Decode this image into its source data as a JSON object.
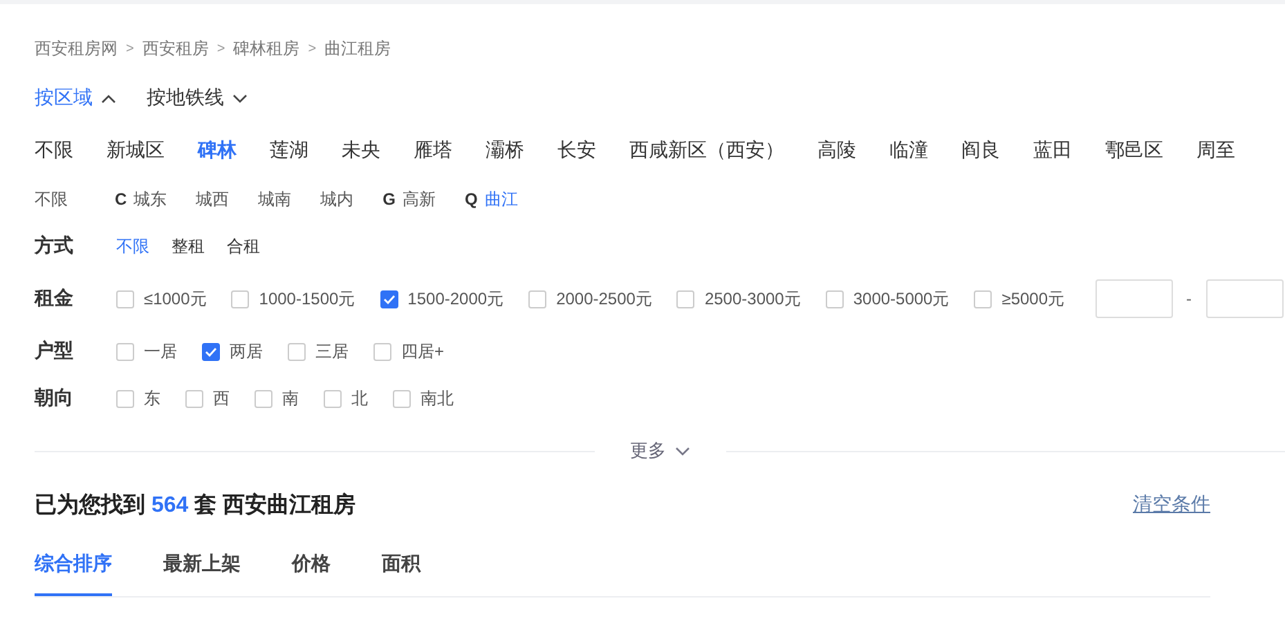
{
  "breadcrumb": [
    "西安租房网",
    "西安租房",
    "碑林租房",
    "曲江租房"
  ],
  "breadcrumb_separator": ">",
  "location_tabs": [
    {
      "label": "按区域",
      "selected": true,
      "expanded": true
    },
    {
      "label": "按地铁线",
      "selected": false,
      "expanded": false
    }
  ],
  "districts": [
    {
      "label": "不限",
      "selected": false
    },
    {
      "label": "新城区",
      "selected": false
    },
    {
      "label": "碑林",
      "selected": true
    },
    {
      "label": "莲湖",
      "selected": false
    },
    {
      "label": "未央",
      "selected": false
    },
    {
      "label": "雁塔",
      "selected": false
    },
    {
      "label": "灞桥",
      "selected": false
    },
    {
      "label": "长安",
      "selected": false
    },
    {
      "label": "西咸新区（西安）",
      "selected": false
    },
    {
      "label": "高陵",
      "selected": false
    },
    {
      "label": "临潼",
      "selected": false
    },
    {
      "label": "阎良",
      "selected": false
    },
    {
      "label": "蓝田",
      "selected": false
    },
    {
      "label": "鄠邑区",
      "selected": false
    },
    {
      "label": "周至",
      "selected": false
    }
  ],
  "areas": [
    {
      "label": "不限",
      "selected": false
    },
    {
      "letter": "C",
      "label": "城东",
      "selected": false
    },
    {
      "label": "城西",
      "selected": false
    },
    {
      "label": "城南",
      "selected": false
    },
    {
      "label": "城内",
      "selected": false
    },
    {
      "letter": "G",
      "label": "高新",
      "selected": false
    },
    {
      "letter": "Q",
      "label": "曲江",
      "selected": true
    }
  ],
  "filters": [
    {
      "label": "方式",
      "kind": "links",
      "options": [
        {
          "label": "不限",
          "selected": true
        },
        {
          "label": "整租",
          "selected": false
        },
        {
          "label": "合租",
          "selected": false
        }
      ]
    },
    {
      "label": "租金",
      "kind": "checkboxes",
      "custom_range": {
        "separator": "-"
      },
      "options": [
        {
          "label": "≤1000元",
          "checked": false
        },
        {
          "label": "1000-1500元",
          "checked": false
        },
        {
          "label": "1500-2000元",
          "checked": true
        },
        {
          "label": "2000-2500元",
          "checked": false
        },
        {
          "label": "2500-3000元",
          "checked": false
        },
        {
          "label": "3000-5000元",
          "checked": false
        },
        {
          "label": "≥5000元",
          "checked": false
        }
      ]
    },
    {
      "label": "户型",
      "kind": "checkboxes",
      "options": [
        {
          "label": "一居",
          "checked": false
        },
        {
          "label": "两居",
          "checked": true
        },
        {
          "label": "三居",
          "checked": false
        },
        {
          "label": "四居+",
          "checked": false
        }
      ]
    },
    {
      "label": "朝向",
      "kind": "checkboxes",
      "options": [
        {
          "label": "东",
          "checked": false
        },
        {
          "label": "西",
          "checked": false
        },
        {
          "label": "南",
          "checked": false
        },
        {
          "label": "北",
          "checked": false
        },
        {
          "label": "南北",
          "checked": false
        }
      ]
    }
  ],
  "more_toggle": {
    "label": "更多",
    "expanded": false
  },
  "result": {
    "prefix": "已为您找到",
    "count": "564",
    "unit": "套",
    "title": "西安曲江租房",
    "clear_link": "清空条件"
  },
  "sort_tabs": [
    {
      "label": "综合排序",
      "selected": true
    },
    {
      "label": "最新上架",
      "selected": false
    },
    {
      "label": "价格",
      "selected": false
    },
    {
      "label": "面积",
      "selected": false
    }
  ]
}
